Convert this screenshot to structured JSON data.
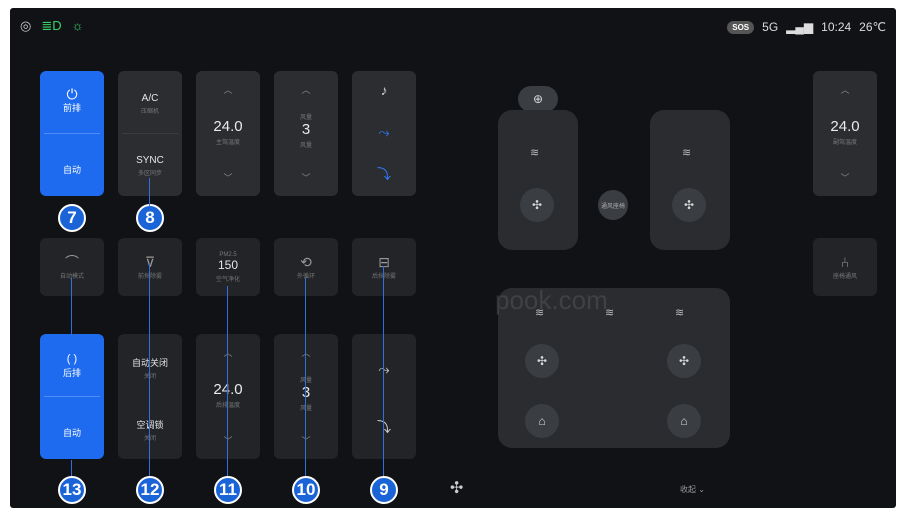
{
  "status": {
    "left_icons": [
      "fog-light-icon",
      "headlight-icon",
      "parking-light-icon"
    ],
    "sos": "SOS",
    "network": "5G",
    "time": "10:24",
    "temp": "26℃"
  },
  "front": {
    "power_label": "前排",
    "auto_label": "自动",
    "ac": {
      "label": "A/C",
      "sub": "压缩机"
    },
    "sync": {
      "label": "SYNC",
      "sub": "多区同步"
    },
    "temp": {
      "value": "24.0",
      "sub": "主驾温度"
    },
    "fan": {
      "top": "风量",
      "value": "3",
      "sub": "风量"
    }
  },
  "row2": {
    "auto_btn": {
      "sub": "自动模式"
    },
    "defrost_front": {
      "sub": "前挡除雾"
    },
    "air_quality": {
      "top": "PM2.5",
      "value": "150",
      "sub": "空气净化"
    },
    "recirc": {
      "sub": "外循环"
    },
    "defrost_rear": {
      "sub": "后挡除雾"
    }
  },
  "rear": {
    "power_label": "后排",
    "auto_label": "自动",
    "auto_off": {
      "label": "自动关闭",
      "sub": "关闭"
    },
    "ac_lock": {
      "label": "空调锁",
      "sub": "关闭"
    },
    "temp": {
      "value": "24.0",
      "sub": "后排温度"
    },
    "fan": {
      "top": "风量",
      "value": "3",
      "sub": "风量"
    }
  },
  "right": {
    "temp": {
      "value": "24.0",
      "sub": "副驾温度"
    },
    "seat_btn": {
      "sub": "座椅通风"
    }
  },
  "seatmap": {
    "center_btn": "通风座椅"
  },
  "bottom": {
    "collapse": "收起 ⌄"
  },
  "markers": [
    "7",
    "8",
    "13",
    "12",
    "11",
    "10",
    "9"
  ],
  "watermark": "pook.com",
  "colors": {
    "accent": "#1e6bf0",
    "marker": "#1a64d8"
  }
}
